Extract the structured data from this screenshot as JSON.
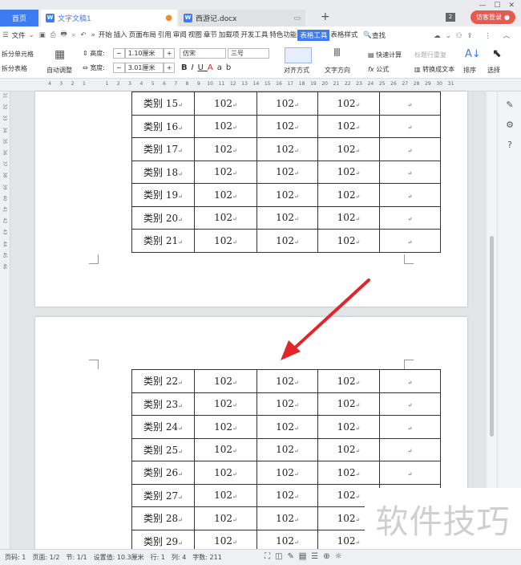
{
  "tabs": {
    "home": "首页",
    "doc1": "文字文稿1",
    "doc2": "西游记.docx",
    "add": "+",
    "badge": "2",
    "visitor": "访客登录"
  },
  "window": {
    "min": "—",
    "max": "☐",
    "close": "✕"
  },
  "menu": {
    "file": "文件",
    "items": [
      "开始",
      "插入",
      "页面布局",
      "引用",
      "审阅",
      "视图",
      "章节",
      "加载项",
      "开发工具",
      "特色功能",
      "表格工具",
      "表格样式"
    ],
    "active": "表格工具",
    "search": "查找"
  },
  "ribbon": {
    "split_cell": "拆分单元格",
    "split_table": "拆分表格",
    "auto_fit": "自动调整",
    "height_label": "高度:",
    "height_value": "1.10厘米",
    "width_label": "宽度:",
    "width_value": "3.01厘米",
    "font": "仿宋",
    "font_size": "三号",
    "align": "对齐方式",
    "text_dir": "文字方向",
    "quick_calc": "快速计算",
    "repeat_header": "标题行重复",
    "formula": "公式",
    "convert_text": "转换成文本",
    "sort": "排序",
    "select": "选择",
    "bold": "B",
    "italic": "I",
    "underline": "U",
    "font_color": "A"
  },
  "ruler_ticks": [
    "4",
    "3",
    "2",
    "1",
    "",
    "1",
    "2",
    "3",
    "4",
    "5",
    "6",
    "7",
    "8",
    "9",
    "10",
    "11",
    "12",
    "13",
    "14",
    "15",
    "16",
    "17",
    "18",
    "19",
    "20",
    "21",
    "22",
    "23",
    "24",
    "25",
    "26",
    "27",
    "28",
    "29",
    "30",
    "31"
  ],
  "vruler_ticks": [
    "31",
    "32",
    "33",
    "34",
    "35",
    "36",
    "37",
    "38",
    "39",
    "40",
    "41",
    "42",
    "43",
    "44",
    "45",
    "46"
  ],
  "page1_rows": [
    {
      "label": "类别 15",
      "v1": "102",
      "v2": "102",
      "v3": "102"
    },
    {
      "label": "类别 16",
      "v1": "102",
      "v2": "102",
      "v3": "102"
    },
    {
      "label": "类别 17",
      "v1": "102",
      "v2": "102",
      "v3": "102"
    },
    {
      "label": "类别 18",
      "v1": "102",
      "v2": "102",
      "v3": "102"
    },
    {
      "label": "类别 19",
      "v1": "102",
      "v2": "102",
      "v3": "102"
    },
    {
      "label": "类别 20",
      "v1": "102",
      "v2": "102",
      "v3": "102"
    },
    {
      "label": "类别 21",
      "v1": "102",
      "v2": "102",
      "v3": "102"
    }
  ],
  "page2_rows": [
    {
      "label": "类别 22",
      "v1": "102",
      "v2": "102",
      "v3": "102"
    },
    {
      "label": "类别 23",
      "v1": "102",
      "v2": "102",
      "v3": "102"
    },
    {
      "label": "类别 24",
      "v1": "102",
      "v2": "102",
      "v3": "102"
    },
    {
      "label": "类别 25",
      "v1": "102",
      "v2": "102",
      "v3": "102"
    },
    {
      "label": "类别 26",
      "v1": "102",
      "v2": "102",
      "v3": "102"
    },
    {
      "label": "类别 27",
      "v1": "102",
      "v2": "102",
      "v3": "102"
    },
    {
      "label": "类别 28",
      "v1": "102",
      "v2": "102",
      "v3": "102"
    },
    {
      "label": "类别 29",
      "v1": "102",
      "v2": "102",
      "v3": "102"
    }
  ],
  "para_mark": "↵",
  "watermark": "软件技巧",
  "status": {
    "page": "页码: 1",
    "pages": "页面: 1/2",
    "section": "节: 1/1",
    "setting": "设置值: 10.3厘米",
    "row": "行: 1",
    "col": "列: 4",
    "words": "字数: 211"
  },
  "colors": {
    "accent": "#3d7bf3",
    "arrow": "#e0262b",
    "visitor": "#e85a4f"
  }
}
